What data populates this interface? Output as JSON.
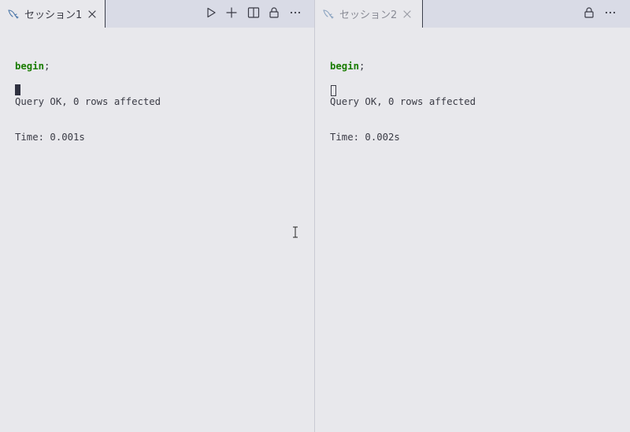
{
  "left_session": {
    "tab": {
      "icon": "mysql-dolphin-icon",
      "label": "セッション1",
      "close_icon": "close-icon"
    },
    "toolbar": {
      "run_icon": "run-triangle-icon",
      "add_icon": "plus-icon",
      "split_icon": "split-editor-icon",
      "lock_icon": "lock-icon",
      "more_icon": "ellipsis-icon"
    },
    "console": {
      "command_keyword": "begin",
      "command_terminator": ";",
      "result": "Query OK, 0 rows affected",
      "time": "Time: 0.001s"
    }
  },
  "right_session": {
    "tab": {
      "icon": "mysql-dolphin-icon",
      "label": "セッション2",
      "close_icon": "close-icon"
    },
    "toolbar": {
      "lock_icon": "lock-icon",
      "more_icon": "ellipsis-icon"
    },
    "console": {
      "command_keyword": "begin",
      "command_terminator": ";",
      "result": "Query OK, 0 rows affected",
      "time": "Time: 0.002s"
    }
  },
  "colors": {
    "background": "#e8e8ec",
    "tabbar": "#d9dbe6",
    "keyword": "#197c00",
    "text": "#3a3b45"
  }
}
